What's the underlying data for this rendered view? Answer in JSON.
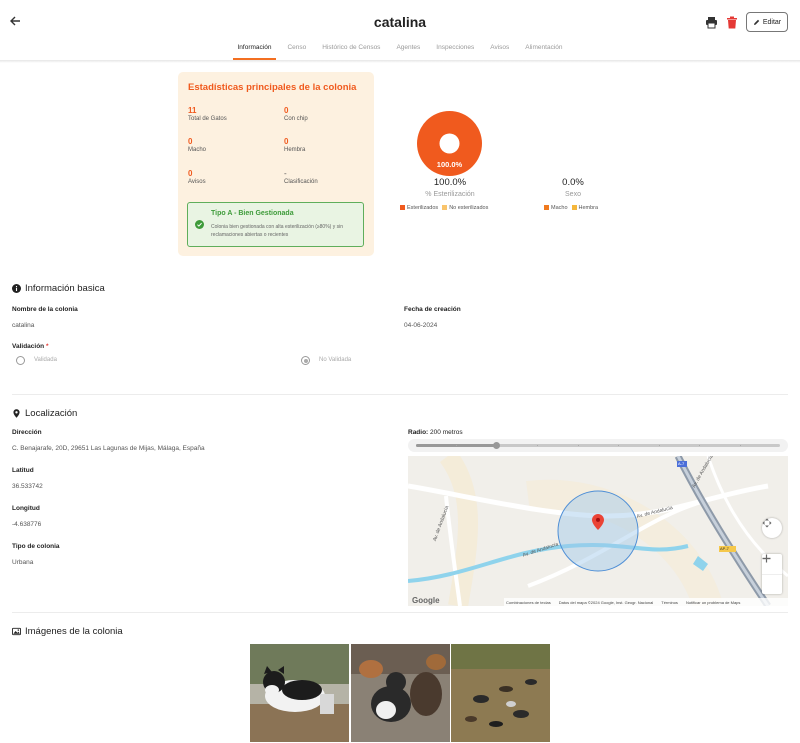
{
  "header": {
    "title": "catalina",
    "edit_label": "Editar"
  },
  "tabs": [
    {
      "label": "Información",
      "active": true
    },
    {
      "label": "Censo"
    },
    {
      "label": "Histórico de Censos"
    },
    {
      "label": "Agentes"
    },
    {
      "label": "Inspecciones"
    },
    {
      "label": "Avisos"
    },
    {
      "label": "Alimentación"
    }
  ],
  "stats": {
    "title": "Estadísticas principales de la colonia",
    "items": [
      {
        "value": "11",
        "label": "Total de Gatos"
      },
      {
        "value": "0",
        "label": "Con chip"
      },
      {
        "value": "0",
        "label": "Macho"
      },
      {
        "value": "0",
        "label": "Hembra"
      },
      {
        "value": "0",
        "label": "Avisos"
      },
      {
        "value": "-",
        "label": "Clasificación"
      }
    ],
    "gestion_title": "Tipo A - Bien Gestionada",
    "gestion_desc": "Colonia bien gestionada con alta esterilización (≥80%) y sin reclamaciones abiertas o recientes"
  },
  "charts": {
    "sterilization": {
      "pie_label": "100.0%",
      "value": "100.0%",
      "caption": "% Esterilización",
      "legend": [
        "Esterilizados",
        "No esterilizados"
      ],
      "colors": [
        "#f05a1e",
        "#f9c46b"
      ],
      "fraction": 1.0
    },
    "sex": {
      "value": "0.0%",
      "caption": "Sexo",
      "legend": [
        "Macho",
        "Hembra"
      ],
      "colors": [
        "#f07a1e",
        "#f5b73b"
      ]
    }
  },
  "basic_info": {
    "heading": "Información basica",
    "name_label": "Nombre de la colonia",
    "name_value": "catalina",
    "date_label": "Fecha de creación",
    "date_value": "04-06-2024",
    "validation_label": "Validación",
    "validation_required": "*",
    "option_validated": "Validada",
    "option_not_validated": "No Validada"
  },
  "location": {
    "heading": "Localización",
    "address_label": "Dirección",
    "address_value": "C. Benajarafe, 20D, 29651 Las Lagunas de Mijas, Málaga, España",
    "lat_label": "Latitud",
    "lat_value": "36.533742",
    "lng_label": "Longitud",
    "lng_value": "-4.638776",
    "type_label": "Tipo de colonia",
    "type_value": "Urbana",
    "radius_label": "Radio:",
    "radius_value": "200 metros",
    "radius_fraction": 0.22,
    "map_footer": [
      "Combinaciones de teclas",
      "Datos del mapa ©2024 Google, Inst. Geogr. Nacional",
      "Términos",
      "Notificar un problema de Maps"
    ],
    "map_streets": [
      "Av. de Andalucía",
      "Av. de Andalucía",
      "Av. de Andalucía",
      "Av. de Andalucía"
    ],
    "road_badges": [
      "A-7",
      "AP-7"
    ],
    "google_logo": "Google"
  },
  "images": {
    "heading": "Imágenes de la colonia"
  }
}
